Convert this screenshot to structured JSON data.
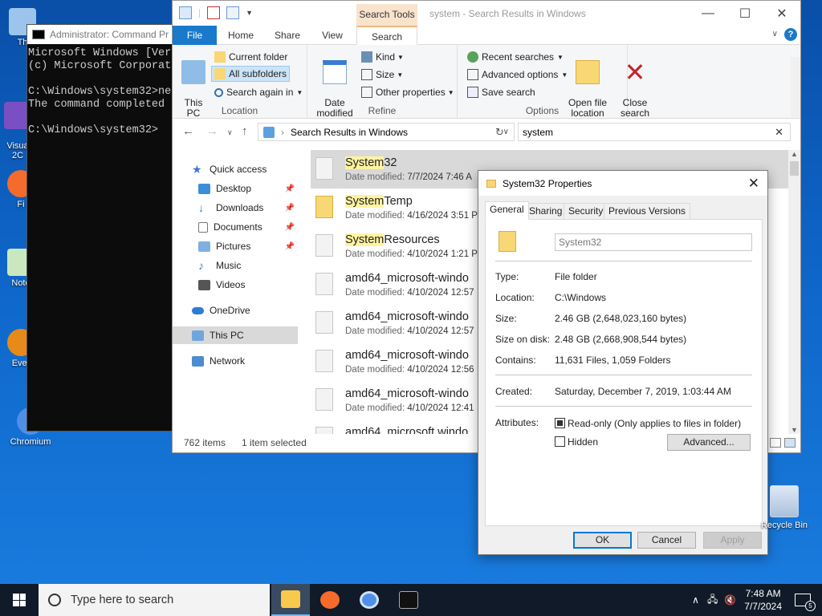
{
  "desktop": {
    "icons": [
      {
        "label": "Th"
      },
      {
        "label": "Visua\n2C"
      },
      {
        "label": "Fi"
      },
      {
        "label": "Note"
      },
      {
        "label": "Ever"
      },
      {
        "label": "Chromium"
      }
    ],
    "recycle_bin": "Recycle Bin"
  },
  "cmd": {
    "title": "Administrator: Command Pr",
    "lines": "Microsoft Windows [Vers\n(c) Microsoft Corporati\n\nC:\\Windows\\system32>net\nThe command completed s\n\nC:\\Windows\\system32>"
  },
  "explorer": {
    "context_tab": "Search Tools",
    "caption": "system - Search Results in Windows",
    "tabs": [
      "File",
      "Home",
      "Share",
      "View",
      "Search"
    ],
    "ribbon": {
      "this_pc": "This\nPC",
      "current_folder": "Current folder",
      "all_subfolders": "All subfolders",
      "search_again": "Search again in",
      "location_label": "Location",
      "date_modified": "Date\nmodified",
      "kind": "Kind",
      "size": "Size",
      "other_properties": "Other properties",
      "refine_label": "Refine",
      "recent_searches": "Recent searches",
      "advanced_options": "Advanced options",
      "save_search": "Save search",
      "open_file_location": "Open file\nlocation",
      "close_search": "Close\nsearch",
      "options_label": "Options"
    },
    "address": "Search Results in Windows",
    "search_value": "system",
    "nav": [
      {
        "label": "Quick access",
        "pinned": false
      },
      {
        "label": "Desktop",
        "pinned": true
      },
      {
        "label": "Downloads",
        "pinned": true
      },
      {
        "label": "Documents",
        "pinned": true
      },
      {
        "label": "Pictures",
        "pinned": true
      },
      {
        "label": "Music",
        "pinned": false
      },
      {
        "label": "Videos",
        "pinned": false
      },
      {
        "label": "OneDrive",
        "pinned": false
      },
      {
        "label": "This PC",
        "pinned": false
      },
      {
        "label": "Network",
        "pinned": false
      }
    ],
    "files": [
      {
        "hl": "System",
        "rest": "32",
        "date": "7/7/2024 7:46 A"
      },
      {
        "hl": "System",
        "rest": "Temp",
        "date": "4/16/2024 3:51 P"
      },
      {
        "hl": "System",
        "rest": "Resources",
        "date": "4/10/2024 1:21 P"
      },
      {
        "hl": "",
        "rest": "amd64_microsoft-windo",
        "date": "4/10/2024 12:57"
      },
      {
        "hl": "",
        "rest": "amd64_microsoft-windo",
        "date": "4/10/2024 12:57"
      },
      {
        "hl": "",
        "rest": "amd64_microsoft-windo",
        "date": "4/10/2024 12:56"
      },
      {
        "hl": "",
        "rest": "amd64_microsoft-windo",
        "date": "4/10/2024 12:41"
      },
      {
        "hl": "",
        "rest": "amd64_microsoft.windo",
        "date": ""
      }
    ],
    "date_prefix": "Date modified: ",
    "status_items": "762 items",
    "status_selected": "1 item selected"
  },
  "properties": {
    "title": "System32 Properties",
    "tabs": [
      "General",
      "Sharing",
      "Security",
      "Previous Versions"
    ],
    "name": "System32",
    "type_label": "Type:",
    "type_value": "File folder",
    "location_label": "Location:",
    "location_value": "C:\\Windows",
    "size_label": "Size:",
    "size_value": "2.46 GB (2,648,023,160 bytes)",
    "size_on_disk_label": "Size on disk:",
    "size_on_disk_value": "2.48 GB (2,668,908,544 bytes)",
    "contains_label": "Contains:",
    "contains_value": "11,631 Files, 1,059 Folders",
    "created_label": "Created:",
    "created_value": "Saturday, December 7, 2019, 1:03:44 AM",
    "attributes_label": "Attributes:",
    "readonly_label": "Read-only (Only applies to files in folder)",
    "hidden_label": "Hidden",
    "advanced_button": "Advanced...",
    "ok": "OK",
    "cancel": "Cancel",
    "apply": "Apply"
  },
  "taskbar": {
    "search_placeholder": "Type here to search",
    "time": "7:48 AM",
    "date": "7/7/2024",
    "notification_count": "5"
  }
}
